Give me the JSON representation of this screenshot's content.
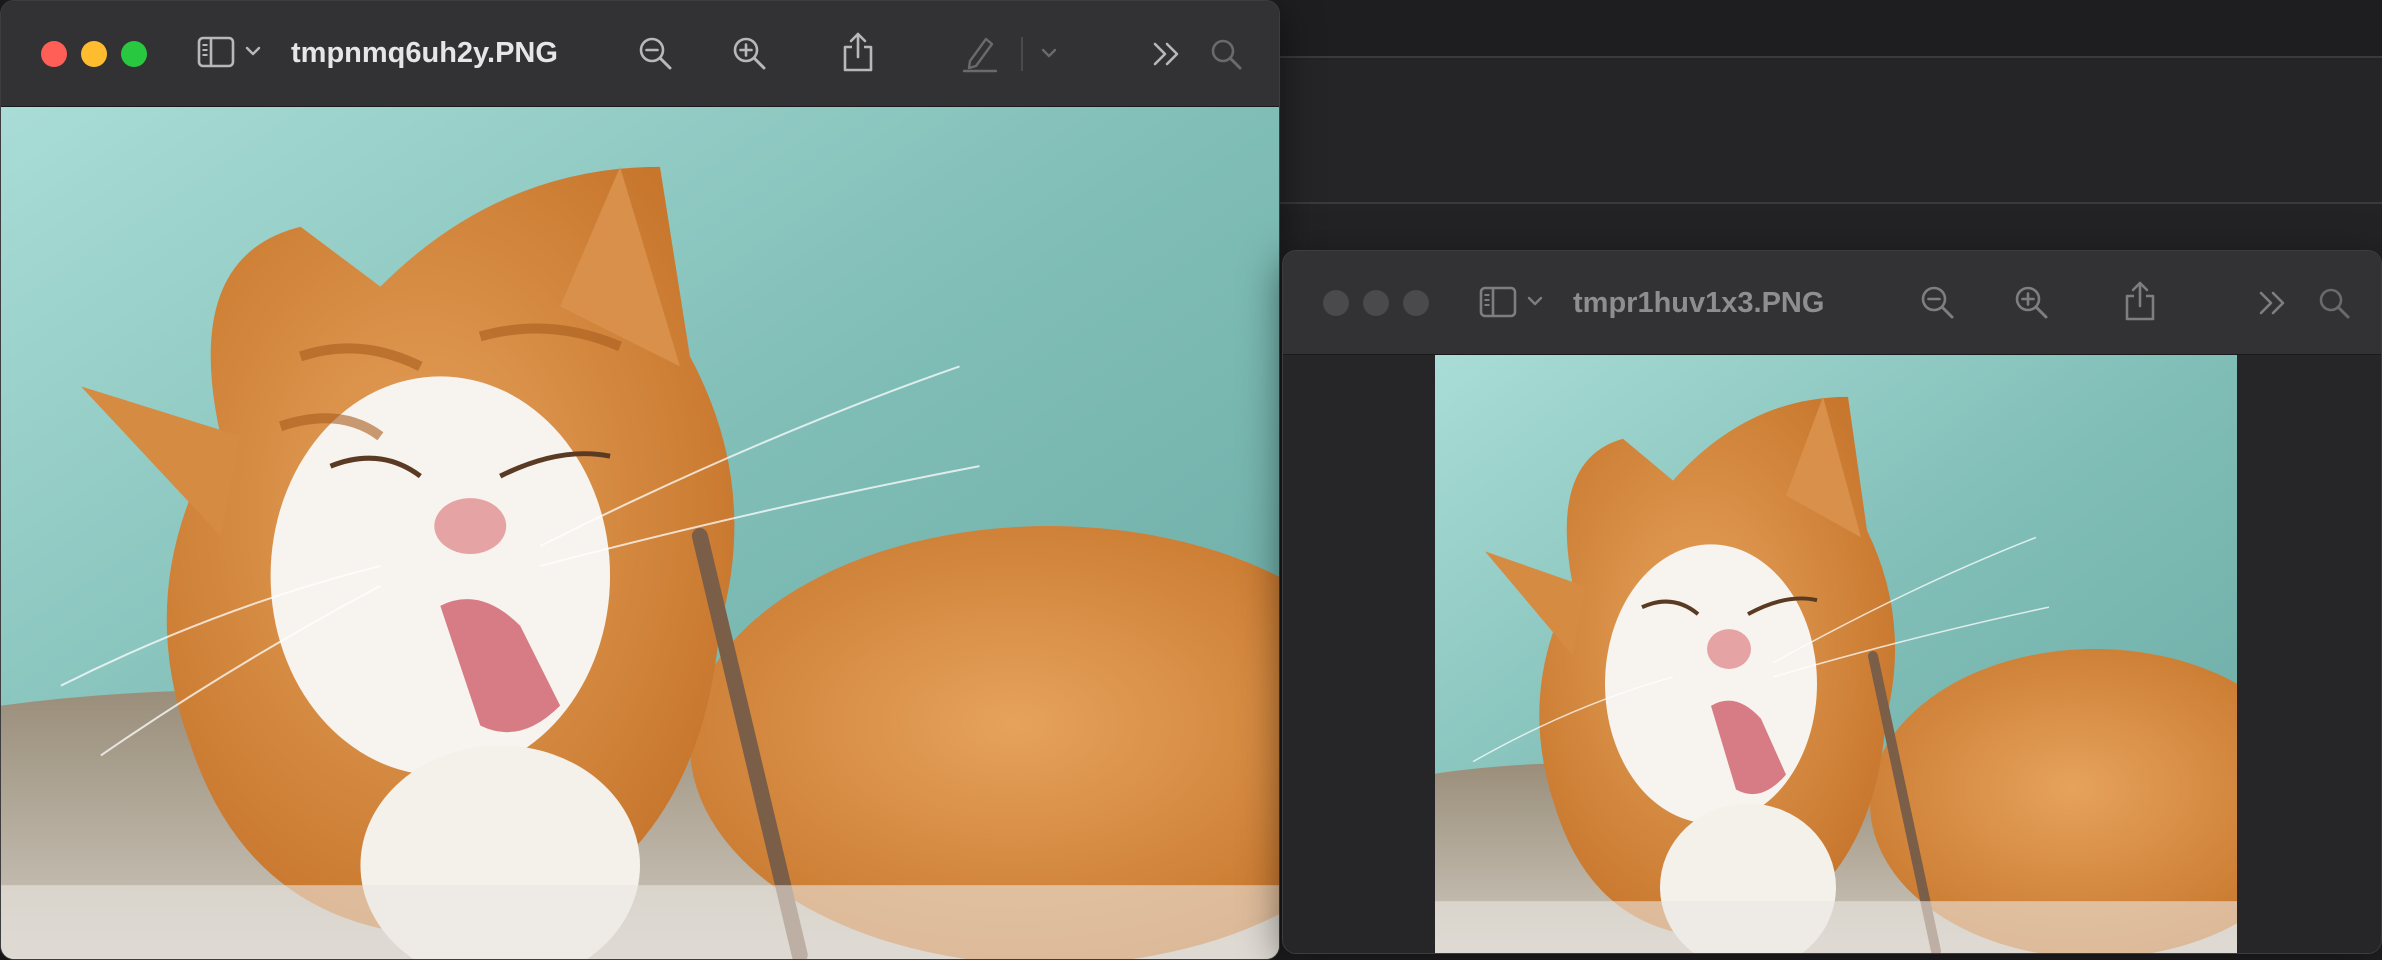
{
  "windows": [
    {
      "id": "front",
      "title": "tmpnmq6uh2y.PNG",
      "active": true,
      "image_subject": "orange-and-white-cat-licking-paw"
    },
    {
      "id": "back",
      "title": "tmpr1huv1x3.PNG",
      "active": false,
      "image_subject": "orange-and-white-cat-licking-paw"
    }
  ],
  "toolbar_icons": [
    "sidebar-icon",
    "chevron-down-icon",
    "zoom-out-icon",
    "zoom-in-icon",
    "share-icon",
    "markup-pen-icon",
    "chevron-down-icon",
    "more-chevrons-icon",
    "search-icon"
  ],
  "colors": {
    "close": "#ff5f57",
    "minimize": "#febc2e",
    "maximize": "#28c840",
    "inactive_dot": "#4a4a4d",
    "titlebar": "#323234",
    "background": "#1c1c1e"
  }
}
